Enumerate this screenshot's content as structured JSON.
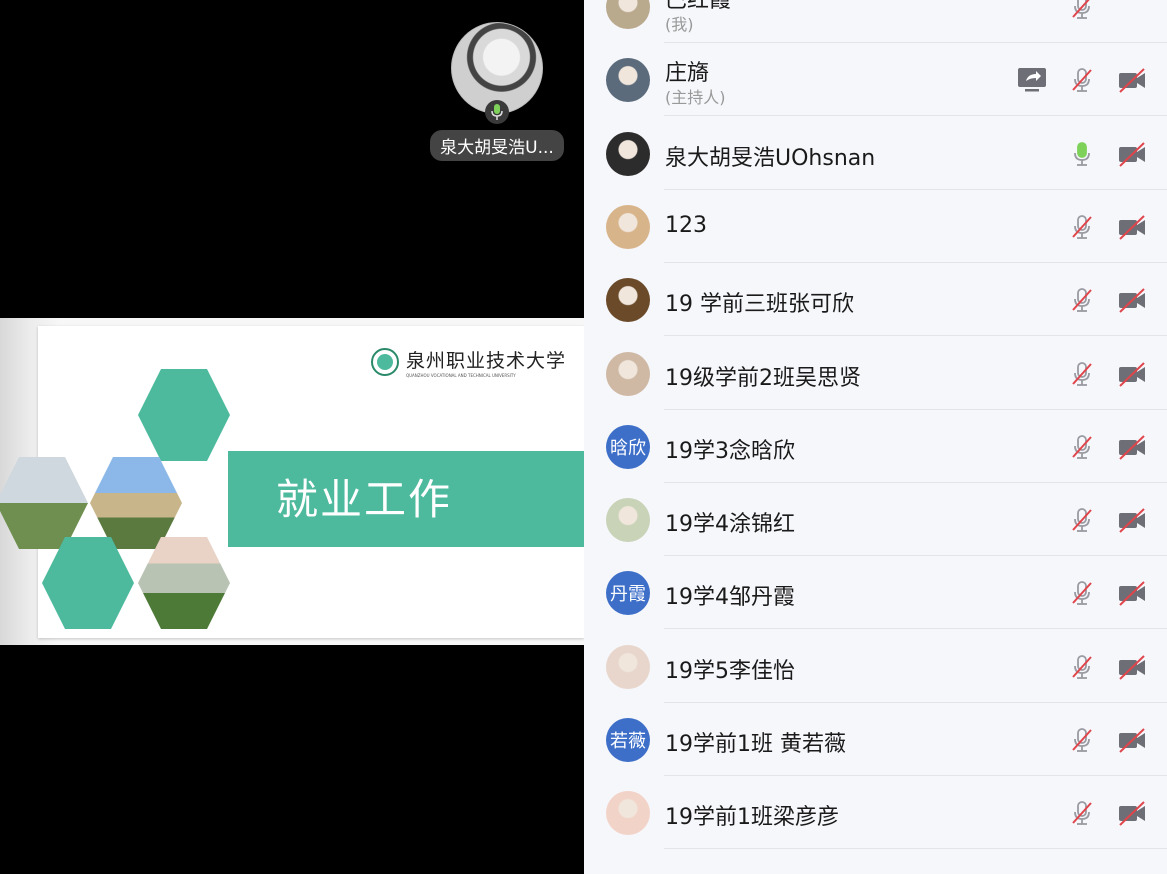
{
  "speaker": {
    "name": "泉大胡旻浩U..."
  },
  "slide": {
    "title": "就业工作",
    "logo_text": "泉州职业技术大学",
    "logo_subtext": "QUANZHOU VOCATIONAL AND TECHNICAL UNIVERSITY"
  },
  "colors": {
    "accent": "#4dba9e",
    "avatar_blue": "#3d6fc8",
    "mic_active": "#7ed25a",
    "muted_red": "#e0454b"
  },
  "participants": [
    {
      "name": "巴红霞",
      "sub": "(我)",
      "avatar_text": "",
      "mic": "muted",
      "video": "none",
      "share": false
    },
    {
      "name": "庄旖",
      "sub": "(主持人)",
      "avatar_text": "",
      "mic": "muted",
      "video": "off",
      "share": true
    },
    {
      "name": "泉大胡旻浩UOhsnan",
      "sub": "",
      "avatar_text": "",
      "mic": "on",
      "video": "off",
      "share": false
    },
    {
      "name": "123",
      "sub": "",
      "avatar_text": "",
      "mic": "muted",
      "video": "off",
      "share": false
    },
    {
      "name": "19 学前三班张可欣",
      "sub": "",
      "avatar_text": "",
      "mic": "muted",
      "video": "off",
      "share": false
    },
    {
      "name": "19级学前2班吴思贤",
      "sub": "",
      "avatar_text": "",
      "mic": "muted",
      "video": "off",
      "share": false
    },
    {
      "name": "19学3念晗欣",
      "sub": "",
      "avatar_text": "晗欣",
      "mic": "muted",
      "video": "off",
      "share": false
    },
    {
      "name": "19学4涂锦红",
      "sub": "",
      "avatar_text": "",
      "mic": "muted",
      "video": "off",
      "share": false
    },
    {
      "name": "19学4邹丹霞",
      "sub": "",
      "avatar_text": "丹霞",
      "mic": "muted",
      "video": "off",
      "share": false
    },
    {
      "name": "19学5李佳怡",
      "sub": "",
      "avatar_text": "",
      "mic": "muted",
      "video": "off",
      "share": false
    },
    {
      "name": "19学前1班 黄若薇",
      "sub": "",
      "avatar_text": "若薇",
      "mic": "muted",
      "video": "off",
      "share": false
    },
    {
      "name": "19学前1班梁彦彦",
      "sub": "",
      "avatar_text": "",
      "mic": "muted",
      "video": "off",
      "share": false
    }
  ]
}
